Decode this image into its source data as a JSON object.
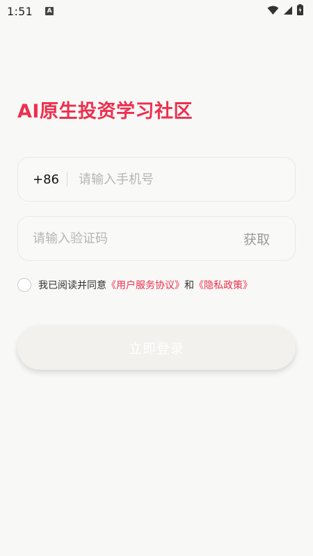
{
  "status_bar": {
    "time": "1:51",
    "notification_letter": "A"
  },
  "login": {
    "title": "AI原生投资学习社区",
    "phone_prefix": "+86",
    "phone_placeholder": "请输入手机号",
    "code_placeholder": "请输入验证码",
    "get_code_label": "获取",
    "agreement_prefix": "我已阅读并同意",
    "agreement_user": "《用户服务协议》",
    "agreement_and": "和",
    "agreement_privacy": "《隐私政策》",
    "login_button": "立即登录"
  },
  "colors": {
    "accent": "#ee2f4e",
    "background": "#f8f8f6"
  }
}
